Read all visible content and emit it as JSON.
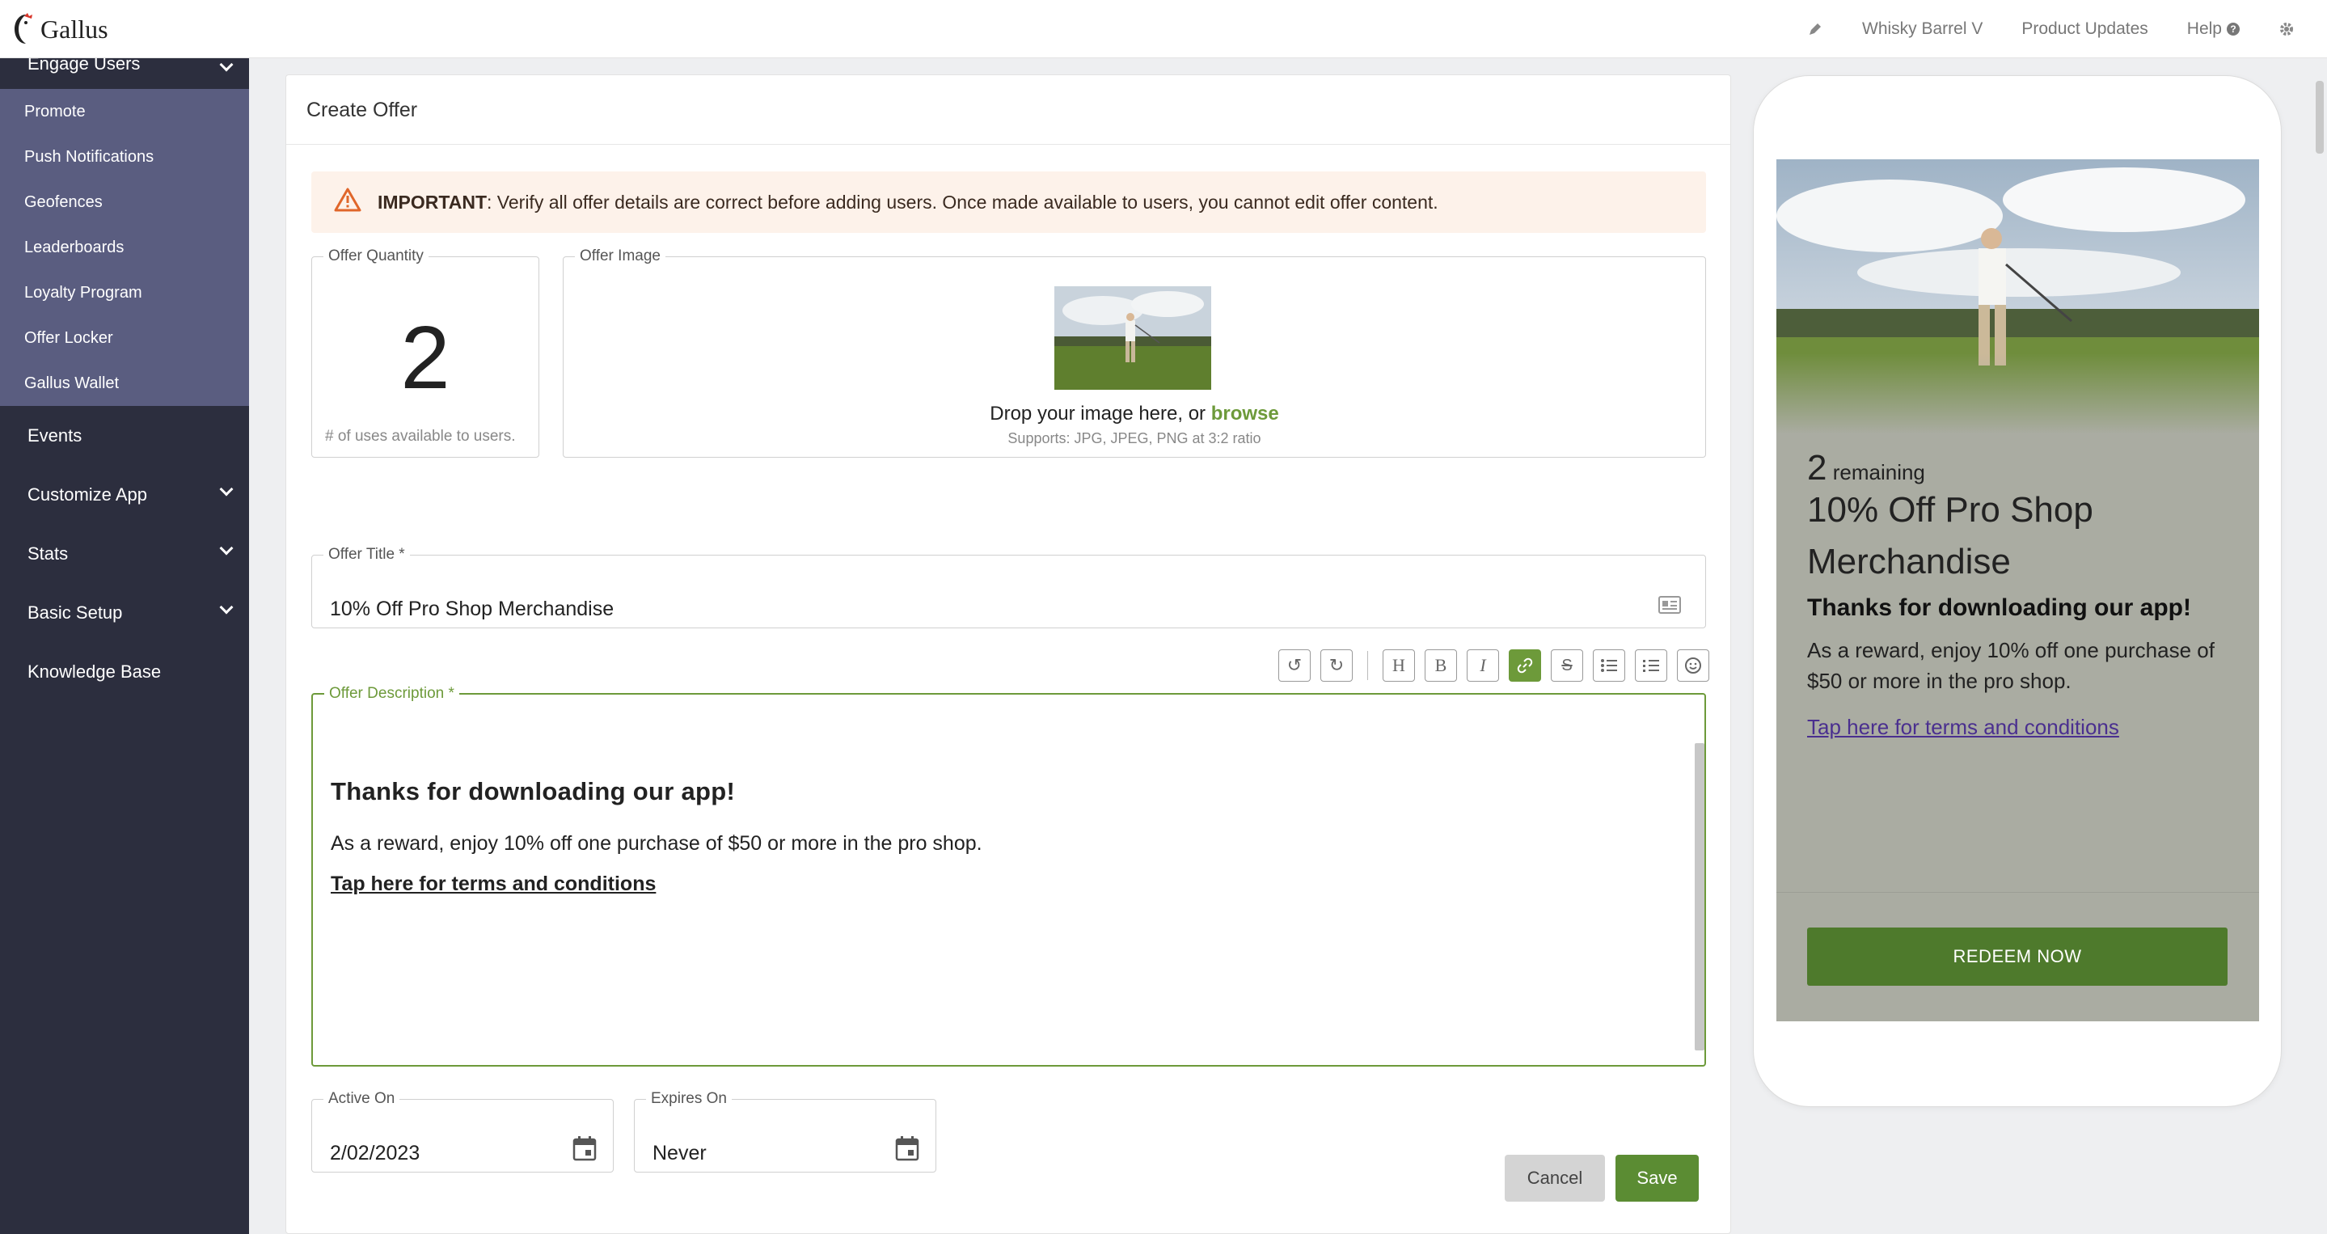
{
  "app": {
    "name": "Gallus"
  },
  "topnav": {
    "account": "Whisky Barrel V",
    "updates": "Product Updates",
    "help": "Help"
  },
  "sidebar": {
    "engage_label": "Engage Users",
    "sub_items": [
      "Promote",
      "Push Notifications",
      "Geofences",
      "Leaderboards",
      "Loyalty Program",
      "Offer Locker",
      "Gallus Wallet"
    ],
    "main_items": [
      "Events",
      "Customize App",
      "Stats",
      "Basic Setup",
      "Knowledge Base"
    ]
  },
  "form": {
    "header": "Create Offer",
    "alert_strong": "IMPORTANT",
    "alert_text": ": Verify all offer details are correct before adding users. Once made available to users, you cannot edit offer content.",
    "quantity_label": "Offer Quantity",
    "quantity_value": "2",
    "quantity_hint": "# of uses available to users.",
    "image_label": "Offer Image",
    "drop_text": "Drop your image here, or ",
    "browse": "browse",
    "drop_sub": "Supports: JPG, JPEG, PNG at 3:2 ratio",
    "title_label": "Offer Title *",
    "title_value": "10% Off Pro Shop Merchandise",
    "desc_label": "Offer Description *",
    "desc_heading": "Thanks for downloading our app!",
    "desc_paragraph": "As a reward, enjoy 10% off one purchase of $50 or more in the pro shop.",
    "desc_link": "Tap here for terms and conditions",
    "active_label": "Active On",
    "active_value": "2/02/2023",
    "expires_label": "Expires On",
    "expires_value": "Never",
    "cancel": "Cancel",
    "save": "Save"
  },
  "preview": {
    "remaining_num": "2",
    "remaining_text": "remaining",
    "title": "10% Off Pro Shop Merchandise",
    "heading": "Thanks for downloading our app!",
    "paragraph": "As a reward, enjoy 10% off one purchase of $50 or more in the pro shop.",
    "link": "Tap here for terms and conditions",
    "button": "REDEEM NOW"
  },
  "colors": {
    "accent": "#6d9a3a",
    "sidebar": "#2c2e3e",
    "sidebar_sub": "#5a5d80",
    "alert_bg": "#fdf2ea"
  }
}
